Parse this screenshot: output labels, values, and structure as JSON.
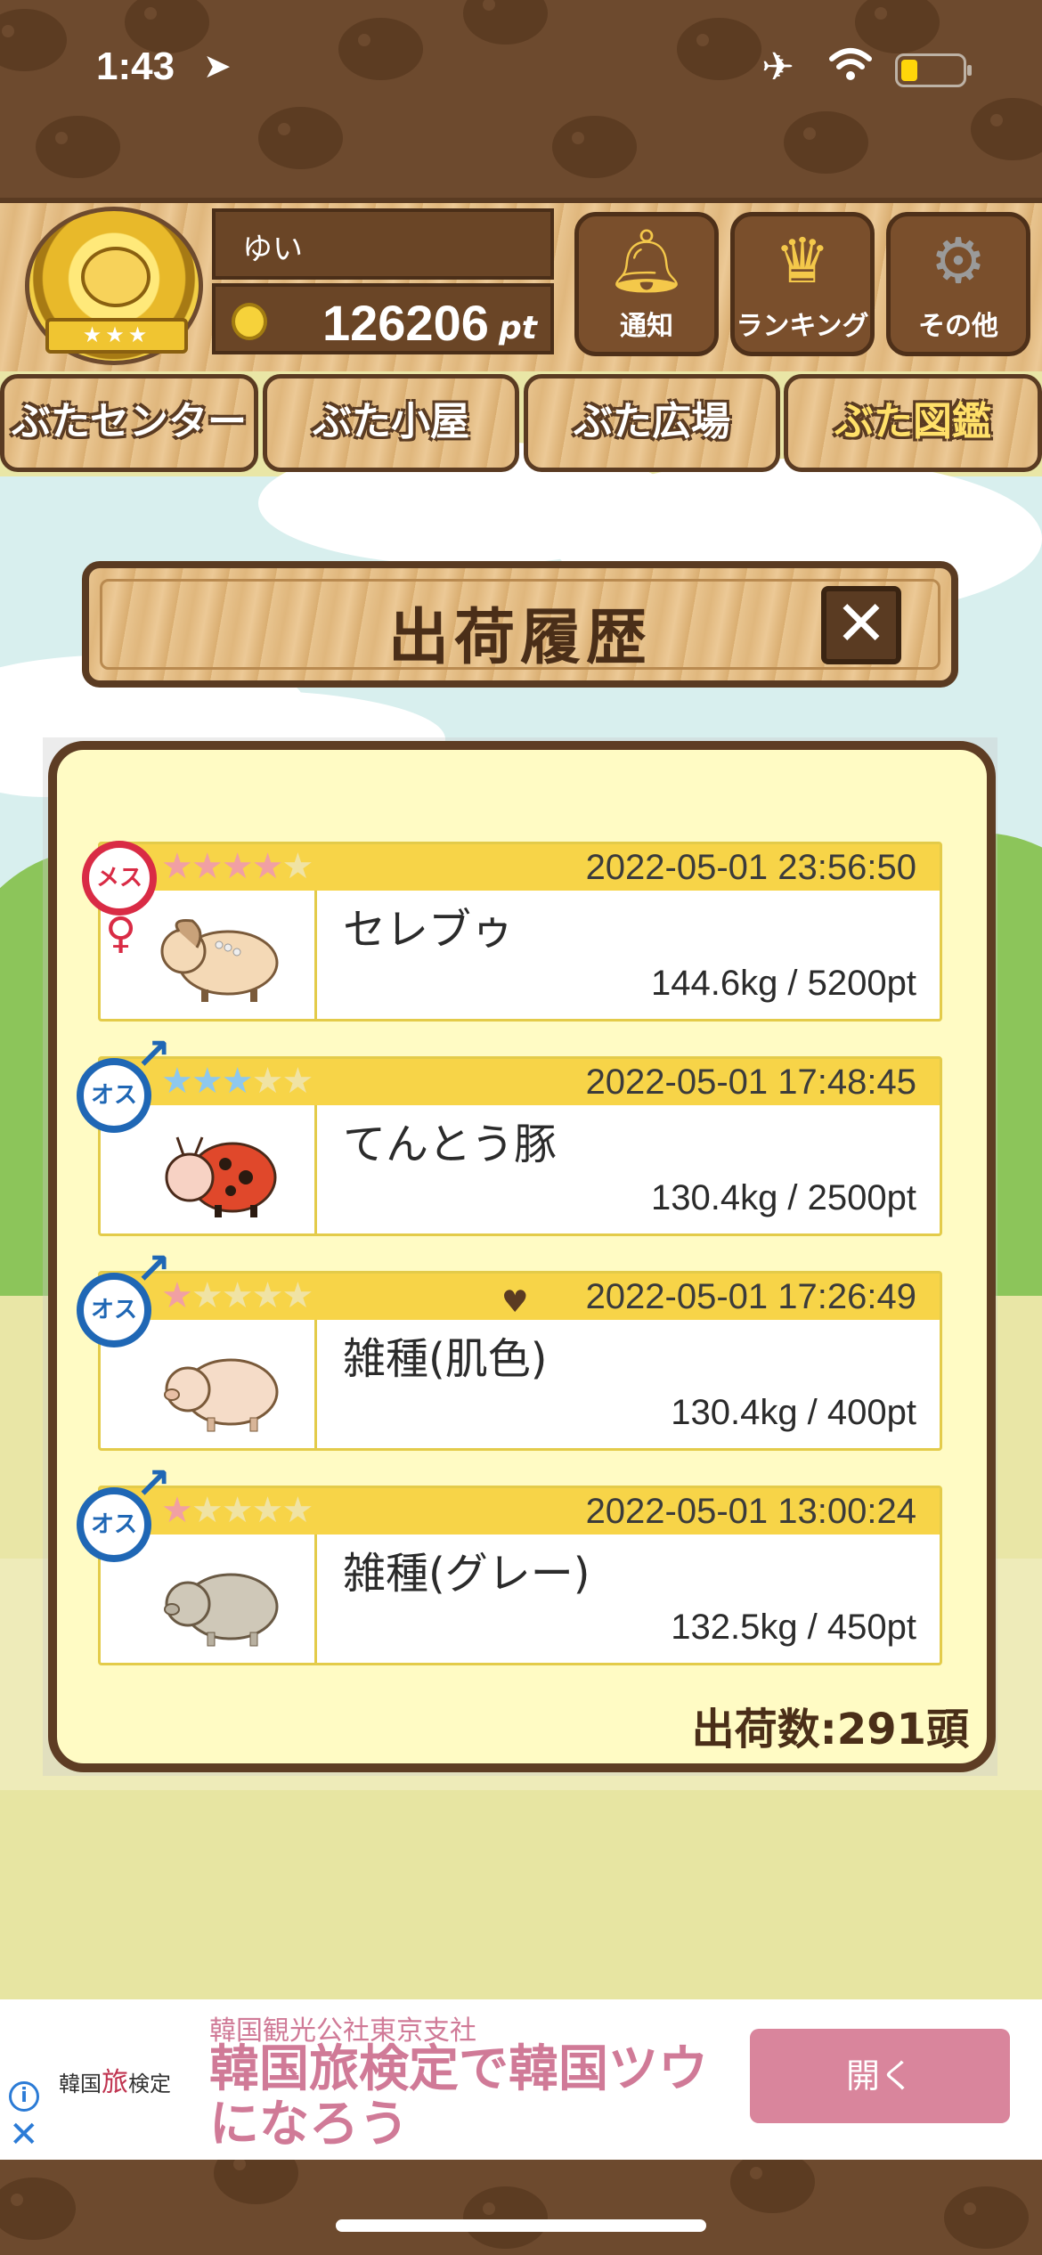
{
  "status_bar": {
    "time": "1:43",
    "icons": [
      "location-arrow-icon",
      "airplane-icon",
      "wifi-icon",
      "battery-icon"
    ]
  },
  "header": {
    "username": "ゆい",
    "points": "126206",
    "points_unit": "pt",
    "buttons": [
      {
        "label": "通知",
        "icon": "bell-icon"
      },
      {
        "label": "ランキング",
        "icon": "crown-icon"
      },
      {
        "label": "その他",
        "icon": "gear-icon"
      }
    ]
  },
  "tabs": [
    {
      "label": "ぶたセンター"
    },
    {
      "label": "ぶた小屋"
    },
    {
      "label": "ぶた広場"
    },
    {
      "label": "ぶた図鑑",
      "active": true
    }
  ],
  "dialog": {
    "title": "出荷履歴",
    "close_glyph": "✕",
    "records": [
      {
        "sex": "female",
        "sex_label": "メス",
        "stars": 4,
        "star_color": "pink",
        "heart": false,
        "date": "2022-05-01 23:56:50",
        "name": "セレブゥ",
        "weight": "144.6kg / 5200pt"
      },
      {
        "sex": "male",
        "sex_label": "オス",
        "stars": 3,
        "star_color": "blue",
        "heart": false,
        "date": "2022-05-01 17:48:45",
        "name": "てんとう豚",
        "weight": "130.4kg / 2500pt"
      },
      {
        "sex": "male",
        "sex_label": "オス",
        "stars": 1,
        "star_color": "pink",
        "heart": true,
        "date": "2022-05-01 17:26:49",
        "name": "雑種(肌色)",
        "weight": "130.4kg / 400pt"
      },
      {
        "sex": "male",
        "sex_label": "オス",
        "stars": 1,
        "star_color": "pink",
        "heart": false,
        "date": "2022-05-01 13:00:24",
        "name": "雑種(グレー)",
        "weight": "132.5kg / 450pt"
      }
    ],
    "total": "出荷数:291頭"
  },
  "ad": {
    "logo_left": "韓国",
    "logo_mid": "旅",
    "logo_right": "検定",
    "sponsor": "韓国観光公社東京支社",
    "headline": "韓国旅検定で韓国ツウになろう",
    "button": "開く"
  },
  "colors": {
    "dirt": "#6d4a2e",
    "wood_dark": "#5a3b22",
    "panel_bg": "#fffbc4",
    "row_bar": "#f7d448",
    "female": "#d92b45",
    "male": "#1f67b5",
    "ad_pink": "#d9859c"
  }
}
